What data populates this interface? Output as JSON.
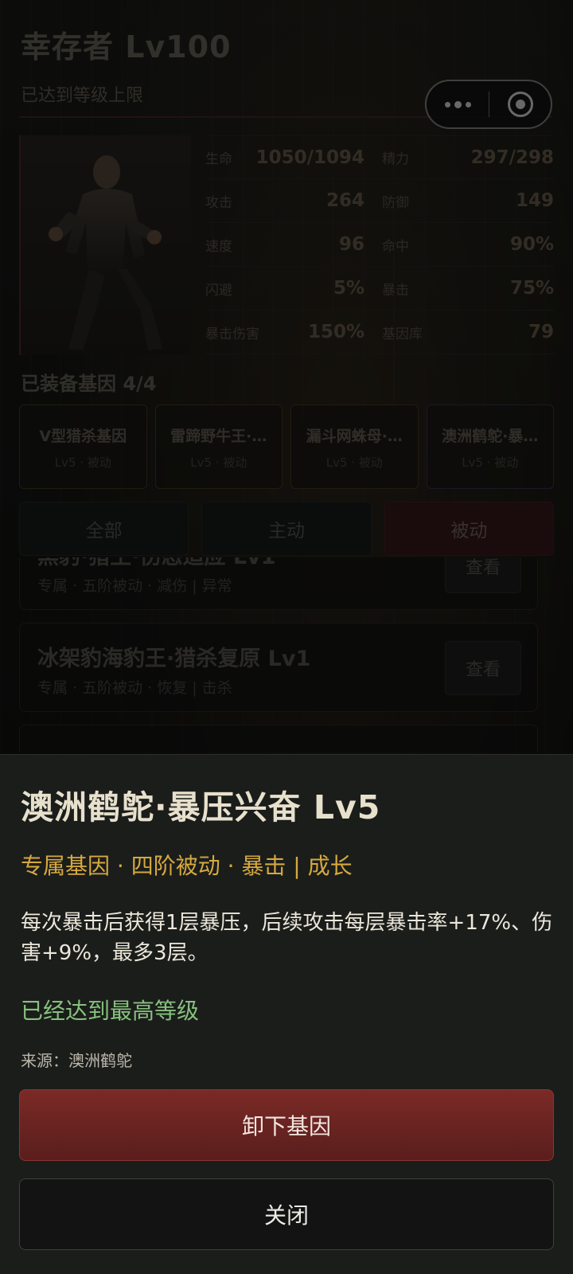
{
  "header": {
    "title": "幸存者 Lv100",
    "subtitle": "已达到等级上限"
  },
  "capsule": {
    "more_icon": "more-dots-icon",
    "close_icon": "target-circle-icon"
  },
  "stats": [
    {
      "label": "生命",
      "value": "1050/1094"
    },
    {
      "label": "精力",
      "value": "297/298"
    },
    {
      "label": "攻击",
      "value": "264"
    },
    {
      "label": "防御",
      "value": "149"
    },
    {
      "label": "速度",
      "value": "96"
    },
    {
      "label": "命中",
      "value": "90%"
    },
    {
      "label": "闪避",
      "value": "5%"
    },
    {
      "label": "暴击",
      "value": "75%"
    },
    {
      "label": "暴击伤害",
      "value": "150%"
    },
    {
      "label": "基因库",
      "value": "79"
    }
  ],
  "equipped": {
    "title": "已装备基因 4/4",
    "slots": [
      {
        "name": "V型猎杀基因",
        "meta": "Lv5 · 被动"
      },
      {
        "name": "雷蹄野牛王·…",
        "meta": "Lv5 · 被动"
      },
      {
        "name": "漏斗网蛛母·…",
        "meta": "Lv5 · 被动"
      },
      {
        "name": "澳洲鹤鸵·暴…",
        "meta": "Lv5 · 被动"
      }
    ]
  },
  "filters": {
    "all": "全部",
    "active": "主动",
    "passive": "被动"
  },
  "list": [
    {
      "name": "黑豹·猎王·伤态适应 Lv1",
      "meta": "专属 · 五阶被动 · 减伤 | 异常",
      "view": "查看"
    },
    {
      "name": "冰架豹海豹王·猎杀复原 Lv1",
      "meta": "专属 · 五阶被动 · 恢复 | 击杀",
      "view": "查看"
    }
  ],
  "detail": {
    "title": "澳洲鹤鸵·暴压兴奋 Lv5",
    "tags": "专属基因 · 四阶被动 · 暴击 | 成长",
    "description": "每次暴击后获得1层暴压，后续攻击每层暴击率+17%、伤害+9%，最多3层。",
    "status": "已经达到最高等级",
    "source": "来源：澳洲鹤鸵",
    "unequip": "卸下基因",
    "close": "关闭"
  },
  "colors": {
    "accent_gold": "#d6a93f",
    "status_green": "#86c17d",
    "danger_red": "#7a2a26"
  }
}
